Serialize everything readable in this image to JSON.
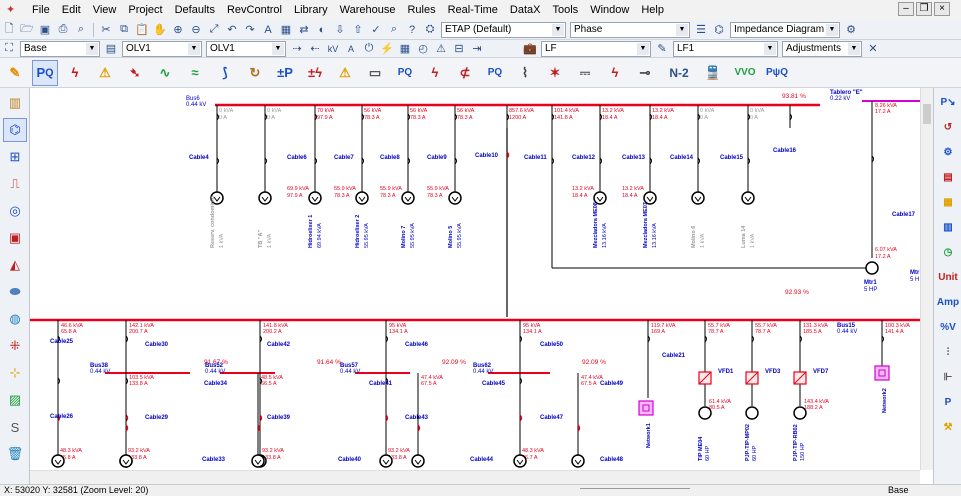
{
  "menu": [
    "File",
    "Edit",
    "View",
    "Project",
    "Defaults",
    "RevControl",
    "Library",
    "Warehouse",
    "Rules",
    "Real-Time",
    "DataX",
    "Tools",
    "Window",
    "Help"
  ],
  "toolbar1": {
    "config_combo": "ETAP (Default)",
    "phase_combo": "Phase",
    "view_combo": "Impedance Diagram"
  },
  "toolbar2": {
    "base_combo": "Base",
    "olv_combo_a": "OLV1",
    "olv_combo_b": "OLV1",
    "lf_combo": "LF",
    "lf1_combo": "LF1",
    "adjustments_combo": "Adjustments"
  },
  "study_toolbar_icons": [
    "load-flow-icon",
    "short-circuit-icon",
    "arc-flash-icon",
    "motor-acceleration-icon",
    "harmonics-icon",
    "transient-stability-icon",
    "protection-icon",
    "reliability-icon",
    "optimal-power-flow-icon",
    "unbalanced-load-flow-icon",
    "battery-icon",
    "dc-load-flow-icon",
    "dc-short-circuit-icon",
    "cable-pulling-icon",
    "ground-grid-icon",
    "underground-raceway-icon",
    "contingency-icon",
    "switching-sequence-icon",
    "n-2-icon",
    "train-icon",
    "volt-var-icon",
    "state-estimator-icon"
  ],
  "study_labels": {
    "n2": "N-2",
    "vvo": "VVO",
    "pq": "PψQ"
  },
  "right_labels": {
    "unit": "Unit",
    "amp": "Amp",
    "pct_v": "%V"
  },
  "top_bus": {
    "name": "Bus6",
    "kv": "0.44 kV",
    "pct": "93.81 %"
  },
  "tablero": {
    "name": "Tablero \"E\"",
    "kv": "0.22 kV",
    "kva": "8.26 kVA",
    "amps": "17.2 A"
  },
  "top_feeders": [
    {
      "kva": "0 kVA",
      "amps": "0 A",
      "cable": "Cable4",
      "load": "Reserv. condominio",
      "rating": "1 kVA",
      "lkva": "",
      "lamps": "",
      "gray": true
    },
    {
      "kva": "0 kVA",
      "amps": "0 A",
      "cable": "",
      "load": "TB \"A\"",
      "rating": "1 kVA",
      "lkva": "",
      "lamps": "",
      "gray": true
    },
    {
      "kva": "70 kVA",
      "amps": "97.9 A",
      "cable": "Cable6",
      "load": "Hidroelixer 1",
      "rating": "69.94 kVA",
      "lkva": "69.9 kVA",
      "lamps": "97.9 A",
      "gray": false
    },
    {
      "kva": "56 kVA",
      "amps": "78.3 A",
      "cable": "Cable7",
      "load": "Hidroelixer 2",
      "rating": "55.95 kVA",
      "lkva": "55.9 kVA",
      "lamps": "78.3 A",
      "gray": false
    },
    {
      "kva": "56 kVA",
      "amps": "78.3 A",
      "cable": "Cable8",
      "load": "Molino 7",
      "rating": "55.95 kVA",
      "lkva": "55.9 kVA",
      "lamps": "78.3 A",
      "gray": false
    },
    {
      "kva": "56 kVA",
      "amps": "78.3 A",
      "cable": "Cable9",
      "load": "Molino 5",
      "rating": "55.95 kVA",
      "lkva": "55.9 kVA",
      "lamps": "78.3 A",
      "gray": false
    },
    {
      "kva": "857.6 kVA",
      "amps": "1200 A",
      "cable": "Cable10",
      "load": "",
      "rating": "",
      "lkva": "",
      "lamps": "",
      "gray": false
    },
    {
      "kva": "101.4 kVA",
      "amps": "141.8 A",
      "cable": "Cable11",
      "load": "",
      "rating": "",
      "lkva": "",
      "lamps": "",
      "gray": false
    },
    {
      "kva": "13.2 kVA",
      "amps": "18.4 A",
      "cable": "Cable12",
      "load": "Mezcladora ME08",
      "rating": "13.16 kVA",
      "lkva": "13.2 kVA",
      "lamps": "18.4 A",
      "gray": false
    },
    {
      "kva": "13.2 kVA",
      "amps": "18.4 A",
      "cable": "Cable13",
      "load": "Mezcladora ME07",
      "rating": "13.16 kVA",
      "lkva": "13.2 kVA",
      "lamps": "18.4 A",
      "gray": false
    },
    {
      "kva": "0 kVA",
      "amps": "0 A",
      "cable": "Cable14",
      "load": "Molino 6",
      "rating": "1 kVA",
      "lkva": "",
      "lamps": "",
      "gray": true
    },
    {
      "kva": "0 kVA",
      "amps": "0 A",
      "cable": "Cable15",
      "load": "Luma 14",
      "rating": "1 kVA",
      "lkva": "",
      "lamps": "",
      "gray": true
    },
    {
      "kva": "",
      "amps": "",
      "cable": "Cable16",
      "load": "",
      "rating": "",
      "lkva": "",
      "lamps": "",
      "gray": false
    }
  ],
  "right_side": {
    "cable17": "Cable17",
    "mtr": "Mtr1",
    "mtr_hp": "5 HP",
    "mtr_kva": "6.07 kVA",
    "mtr_amps": "17.2 A",
    "mtr2": "Mtr",
    "mtr2_hp": "5 H",
    "pct_mid": "92.93 %"
  },
  "lower_bus": {
    "name": "Bus15",
    "kv": "0.44 kV"
  },
  "lower_feeders": [
    {
      "kva": "46.6 kVA",
      "amps": "65.8 A"
    },
    {
      "kva": "142.1 kVA",
      "amps": "200.7 A"
    },
    {
      "kva": "141.8 kVA",
      "amps": "200.2 A"
    },
    {
      "kva": "95 kVA",
      "amps": "134.1 A"
    },
    {
      "kva": "95 kVA",
      "amps": "134.1 A"
    },
    {
      "kva": "119.7 kVA",
      "amps": "169 A"
    },
    {
      "kva": "55.7 kVA",
      "amps": "78.7 A"
    },
    {
      "kva": "55.7 kVA",
      "amps": "78.7 A"
    },
    {
      "kva": "131.3 kVA",
      "amps": "185.5 A"
    },
    {
      "kva": "100.3 kVA",
      "amps": "141.4 A"
    }
  ],
  "sub_buses": [
    {
      "name": "Bus38",
      "kv": "0.44 kV",
      "pct": "91.67 %"
    },
    {
      "name": "Bus52",
      "kv": "0.44 kV",
      "pct": "91.64 %"
    },
    {
      "name": "Bus57",
      "kv": "0.44 kV",
      "pct": "92.09 %"
    },
    {
      "name": "Bus62",
      "kv": "0.44 kV",
      "pct": "92.09 %"
    }
  ],
  "lower_labels": {
    "cable25": "Cable25",
    "cable26": "Cable26",
    "cable30": "Cable30",
    "cable29": "Cable29",
    "cable42": "Cable42",
    "cable34": "Cable34",
    "cable39": "Cable39",
    "cable33": "Cable33",
    "cable46": "Cable46",
    "cable41": "Cable41",
    "cable43": "Cable43",
    "cable40": "Cable40",
    "cable50": "Cable50",
    "cable45": "Cable45",
    "cable47": "Cable47",
    "cable44": "Cable44",
    "cable49": "Cable49",
    "cable48": "Cable48",
    "cable21": "Cable21",
    "vfd1": "VFD1",
    "vfd3": "VFD3",
    "vfd7": "VFD7",
    "network1": "Network1",
    "network2": "Network2",
    "tip_me04": "TIP ME04",
    "tip_me04_hp": "60 HP",
    "pjp_mp02": "PJP-TIP-MP02",
    "pjp_mp02_hp": "60 HP",
    "pjp_rb02": "PJP-TIP-RB02",
    "pjp_rb02_hp": "150 HP",
    "r1a": "103.5 kVA",
    "r1b": "133.8 A",
    "r2a": "48.3 kVA",
    "r2b": "65.8 A",
    "r3a": "93.2 kVA",
    "r3b": "133.8 A",
    "r4a": "48.5 kVA",
    "r4b": "66.5 A",
    "r5a": "93.2 kVA",
    "r5b": "133.8 A",
    "r6a": "47.4 kVA",
    "r6b": "67.5 A",
    "r7a": "48.3 kVA",
    "r7b": "66.7 A",
    "r8a": "47.4 kVA",
    "r8b": "67.5 A",
    "r9a": "61.4 kVA",
    "r9b": "80.5 A",
    "r10a": "143.4 kVA",
    "r10b": "188.2 A",
    "r11a": "48.3 kVA",
    "r11b": "65.8 A",
    "r12a": "93.2 kVA",
    "r12b": "133.8 A"
  },
  "status": {
    "coords": "X: 53020   Y: 32581 (Zoom Level: 20)",
    "mode": "Base"
  },
  "colors": {
    "bus": "#e8001c",
    "panel_bus": "#d400d4",
    "label": "#0000c8",
    "value": "#e8001c",
    "gray_label": "#9a9a9a",
    "line": "#000000"
  }
}
